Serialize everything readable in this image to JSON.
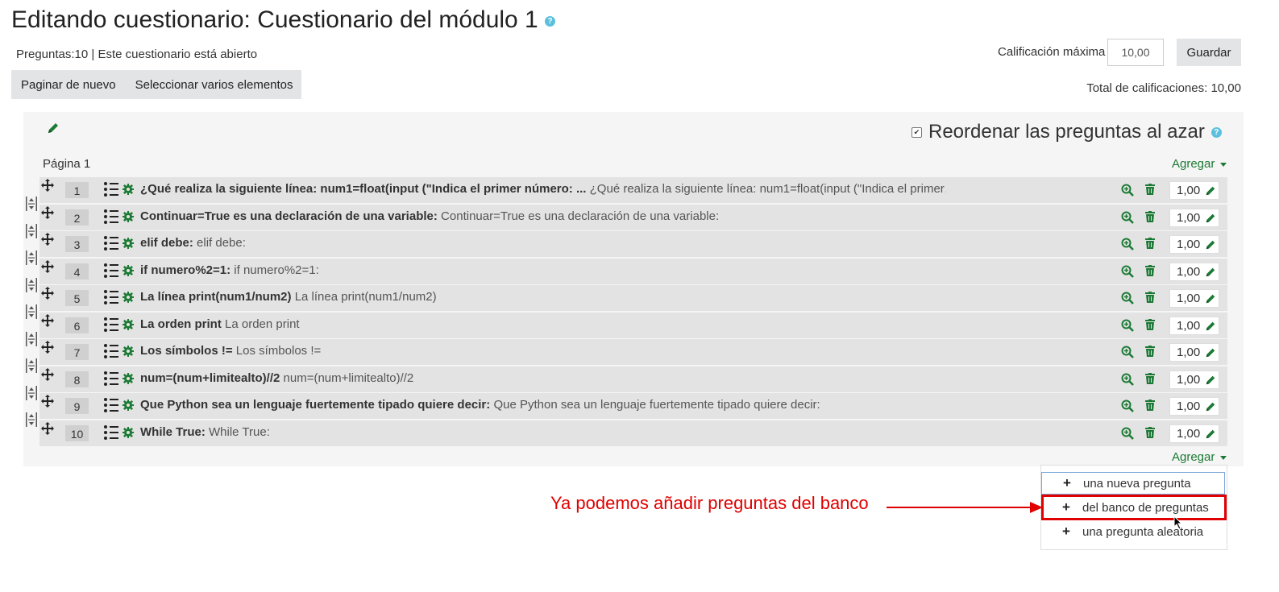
{
  "page": {
    "title": "Editando cuestionario: Cuestionario del módulo 1",
    "status": "Preguntas:10 | Este cuestionario está abierto"
  },
  "toolbar": {
    "repaginate_label": "Paginar de nuevo",
    "select_multiple_label": "Seleccionar varios elementos"
  },
  "grade": {
    "max_label": "Calificación máxima",
    "max_value": "10,00",
    "save_label": "Guardar",
    "total_label": "Total de calificaciones: 10,00"
  },
  "section": {
    "shuffle_label": "Reordenar las preguntas al azar",
    "shuffle_checked": true,
    "page_label": "Página 1",
    "add_label": "Agregar"
  },
  "questions": [
    {
      "num": "1",
      "name": "¿Qué realiza la siguiente línea: num1=float(input (\"Indica el primer número: ...",
      "text": "¿Qué realiza la siguiente línea: num1=float(input (\"Indica el primer",
      "ellipsis": "…",
      "mark": "1,00"
    },
    {
      "num": "2",
      "name": "Continuar=True es una declaración de una variable:",
      "text": "Continuar=True es una declaración de una variable:",
      "ellipsis": "",
      "mark": "1,00"
    },
    {
      "num": "3",
      "name": "elif debe:",
      "text": "elif debe:",
      "ellipsis": "",
      "mark": "1,00"
    },
    {
      "num": "4",
      "name": "if numero%2=1:",
      "text": "if numero%2=1:",
      "ellipsis": "",
      "mark": "1,00"
    },
    {
      "num": "5",
      "name": "La línea print(num1/num2)",
      "text": "La línea print(num1/num2)",
      "ellipsis": "",
      "mark": "1,00"
    },
    {
      "num": "6",
      "name": "La orden print",
      "text": "La orden print",
      "ellipsis": "",
      "mark": "1,00"
    },
    {
      "num": "7",
      "name": "Los símbolos !=",
      "text": "Los símbolos !=",
      "ellipsis": "",
      "mark": "1,00"
    },
    {
      "num": "8",
      "name": "num=(num+limitealto)//2",
      "text": "num=(num+limitealto)//2",
      "ellipsis": "",
      "mark": "1,00"
    },
    {
      "num": "9",
      "name": "Que Python sea un lenguaje fuertemente tipado quiere decir:",
      "text": "Que Python sea un lenguaje fuertemente tipado quiere decir:",
      "ellipsis": "",
      "mark": "1,00"
    },
    {
      "num": "10",
      "name": "While True:",
      "text": "While True:",
      "ellipsis": "",
      "mark": "1,00"
    }
  ],
  "add_menu": {
    "items": [
      {
        "label": "una nueva pregunta"
      },
      {
        "label": "del banco de preguntas"
      },
      {
        "label": "una pregunta aleatoria"
      }
    ]
  },
  "annotation": {
    "text": "Ya podemos añadir preguntas del banco",
    "color": "#e00000"
  },
  "colors": {
    "accent_green": "#1c7a35",
    "help_blue": "#5bc0de"
  }
}
